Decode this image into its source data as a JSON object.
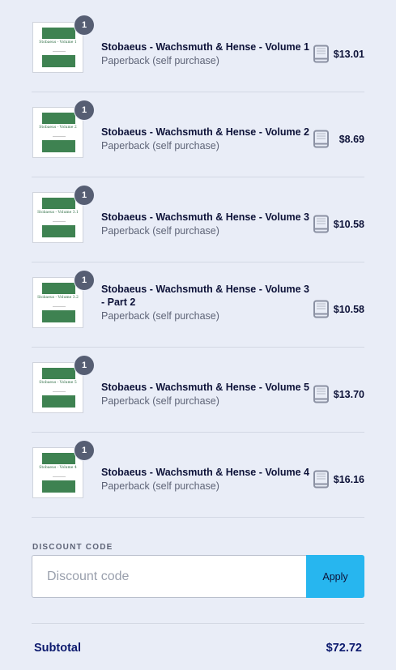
{
  "cart": {
    "items": [
      {
        "qty": "1",
        "title": "Stobaeus - Wachsmuth & Hense - Volume 1",
        "subtitle": "Paperback (self purchase)",
        "price": "$13.01",
        "cover_text": "Stobaeus - Volume 1"
      },
      {
        "qty": "1",
        "title": "Stobaeus - Wachsmuth & Hense - Volume 2",
        "subtitle": "Paperback (self purchase)",
        "price": "$8.69",
        "cover_text": "Stobaeus - Volume 2"
      },
      {
        "qty": "1",
        "title": "Stobaeus - Wachsmuth & Hense - Volume 3",
        "subtitle": "Paperback (self purchase)",
        "price": "$10.58",
        "cover_text": "Stobaeus - Volume 3.1"
      },
      {
        "qty": "1",
        "title": "Stobaeus - Wachsmuth & Hense - Volume 3 - Part 2",
        "subtitle": "Paperback (self purchase)",
        "price": "$10.58",
        "cover_text": "Stobaeus - Volume 3.2"
      },
      {
        "qty": "1",
        "title": "Stobaeus - Wachsmuth & Hense - Volume 5",
        "subtitle": "Paperback (self purchase)",
        "price": "$13.70",
        "cover_text": "Stobaeus - Volume 5"
      },
      {
        "qty": "1",
        "title": "Stobaeus - Wachsmuth & Hense - Volume 4",
        "subtitle": "Paperback (self purchase)",
        "price": "$16.16",
        "cover_text": "Stobaeus - Volume 4"
      }
    ],
    "item_icon": "book-icon"
  },
  "discount": {
    "label": "DISCOUNT CODE",
    "placeholder": "Discount code",
    "value": "",
    "apply_label": "Apply"
  },
  "summary": {
    "subtotal_label": "Subtotal",
    "subtotal_value": "$72.72"
  },
  "colors": {
    "background": "#e9edf7",
    "badge": "#565e73",
    "cover_green": "#3e8251",
    "apply_button": "#27b6ef",
    "subtotal_text": "#0c1a6e"
  }
}
